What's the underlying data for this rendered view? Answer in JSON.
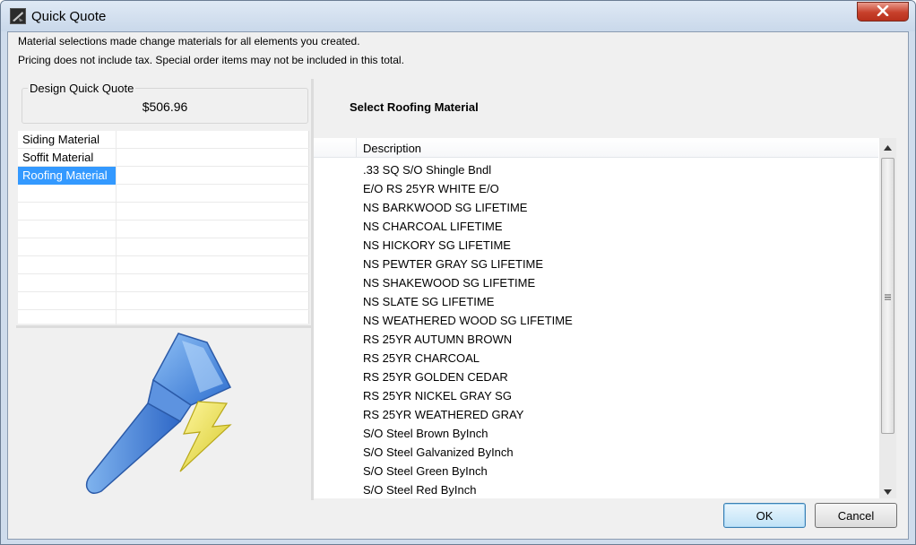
{
  "window": {
    "title": "Quick Quote"
  },
  "info": {
    "line1": "Material selections made change materials for all elements you created.",
    "line2": "Pricing does not include tax. Special order items may not be included in this total."
  },
  "quote": {
    "label": "Design Quick Quote",
    "value": "$506.96"
  },
  "materials": {
    "items": [
      "Siding Material",
      "Soffit Material",
      "Roofing Material"
    ],
    "selected": "Roofing Material"
  },
  "list": {
    "title": "Select Roofing Material",
    "column_header": "Description",
    "rows": [
      ".33 SQ S/O Shingle Bndl",
      "E/O RS 25YR WHITE E/O",
      "NS BARKWOOD SG LIFETIME",
      "NS CHARCOAL LIFETIME",
      "NS HICKORY SG LIFETIME",
      "NS PEWTER GRAY SG LIFETIME",
      "NS SHAKEWOOD SG LIFETIME",
      "NS SLATE SG LIFETIME",
      "NS WEATHERED WOOD SG LIFETIME",
      "RS 25YR AUTUMN BROWN",
      "RS 25YR CHARCOAL",
      "RS 25YR GOLDEN CEDAR",
      "RS 25YR NICKEL GRAY SG",
      "RS 25YR WEATHERED GRAY",
      "S/O Steel Brown ByInch",
      "S/O Steel Galvanized ByInch",
      "S/O Steel Green ByInch",
      "S/O Steel Red ByInch"
    ]
  },
  "buttons": {
    "ok": "OK",
    "cancel": "Cancel"
  },
  "icons": {
    "app": "app-icon",
    "close": "close-icon",
    "brush": "paintbrush-lightning-icon",
    "scroll_up": "chevron-up-icon",
    "scroll_down": "chevron-down-icon",
    "grip": "scroll-grip-icon"
  },
  "colors": {
    "selection": "#3399ff",
    "close_button": "#c7402b",
    "brush_blue": "#3f7fd9",
    "bolt_yellow": "#e6e04a"
  }
}
